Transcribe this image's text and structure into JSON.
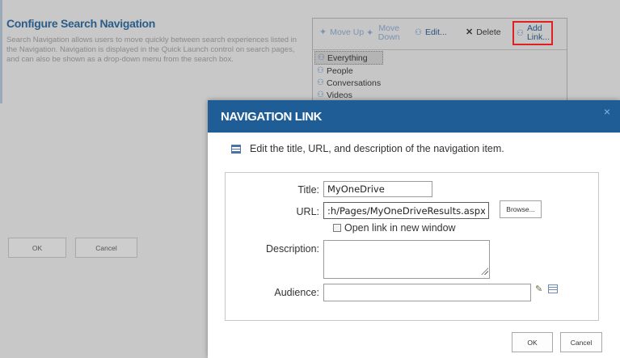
{
  "background": {
    "title": "Configure Search Navigation",
    "description": "Search Navigation allows users to move quickly between search experiences listed in the Navigation. Navigation is displayed in the Quick Launch control on search pages, and can also be shown as a drop-down menu from the search box.",
    "toolbar": {
      "move_up": "Move Up",
      "move_down": "Move Down",
      "edit": "Edit...",
      "delete": "Delete",
      "add_link": "Add Link..."
    },
    "nav_items": [
      "Everything",
      "People",
      "Conversations",
      "Videos"
    ],
    "ok_label": "OK",
    "cancel_label": "Cancel"
  },
  "dialog": {
    "title": "NAVIGATION LINK",
    "close": "×",
    "intro": "Edit the title, URL, and description of the navigation item.",
    "title_label": "Title:",
    "title_value": "MyOneDrive",
    "url_label": "URL:",
    "url_value": ":h/Pages/MyOneDriveResults.aspx",
    "browse_label": "Browse...",
    "new_window_label": "Open link in new window",
    "description_label": "Description:",
    "description_value": "",
    "audience_label": "Audience:",
    "audience_value": "",
    "ok_label": "OK",
    "cancel_label": "Cancel"
  },
  "colors": {
    "header": "#1f5d96",
    "highlight": "#e02020",
    "overlay": "#c8c8c8"
  }
}
